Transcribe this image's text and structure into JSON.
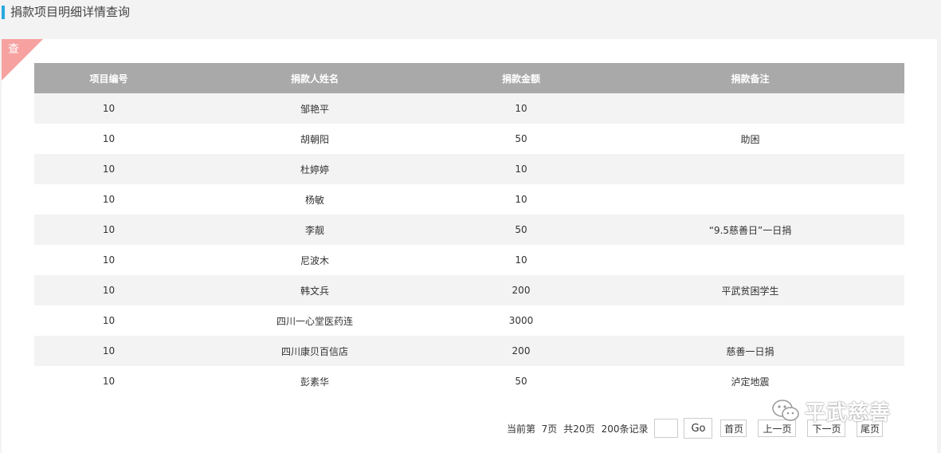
{
  "header": {
    "title": "捐款项目明细详情查询"
  },
  "corner_tag": {
    "label": "查",
    "color": "#f7a1a1"
  },
  "table": {
    "columns": [
      "项目编号",
      "捐款人姓名",
      "捐款金额",
      "捐款备注"
    ],
    "rows": [
      [
        "10",
        "邹艳平",
        "10",
        ""
      ],
      [
        "10",
        "胡朝阳",
        "50",
        "助困"
      ],
      [
        "10",
        "杜婷婷",
        "10",
        ""
      ],
      [
        "10",
        "杨敏",
        "10",
        ""
      ],
      [
        "10",
        "李靓",
        "50",
        "“9.5慈善日”一日捐"
      ],
      [
        "10",
        "尼波木",
        "10",
        ""
      ],
      [
        "10",
        "韩文兵",
        "200",
        "平武贫困学生"
      ],
      [
        "10",
        "四川一心堂医药连",
        "3000",
        ""
      ],
      [
        "10",
        "四川康贝百信店",
        "200",
        "慈善一日捐"
      ],
      [
        "10",
        "彭素华",
        "50",
        "泸定地震"
      ]
    ]
  },
  "pager": {
    "current_label": "当前第",
    "current_page": "7页",
    "total_pages": "共20页",
    "total_records": "200条记录",
    "page_input_value": "",
    "go_label": "Go",
    "first_label": "首页",
    "prev_label": "上一页",
    "next_label": "下一页",
    "last_label": "尾页"
  },
  "watermark": {
    "text": "平武慈善",
    "icon": "wechat-icon"
  },
  "colors": {
    "accent": "#29a9e0",
    "table_header": "#a9a9a9",
    "row_alt": "#f3f3f3"
  }
}
